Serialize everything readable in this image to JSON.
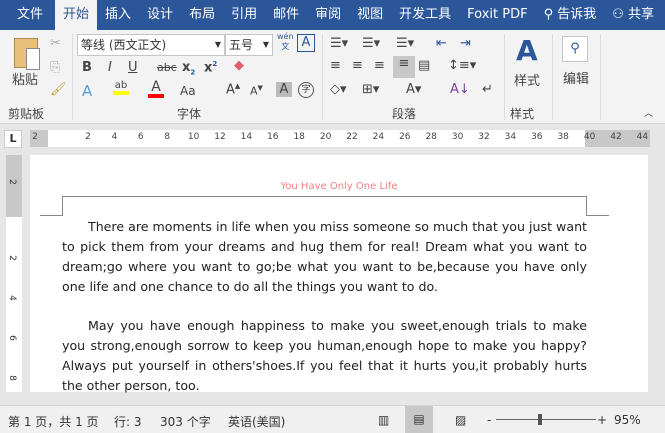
{
  "tabs": [
    "文件",
    "开始",
    "插入",
    "设计",
    "布局",
    "引用",
    "邮件",
    "审阅",
    "视图",
    "开发工具",
    "Foxit PDF"
  ],
  "active_tab": "开始",
  "tell_me": "告诉我",
  "share": "共享",
  "ribbon": {
    "paste": "粘贴",
    "font_name": "等线 (西文正文)",
    "font_size": "五号",
    "styles": "样式",
    "editing": "编辑",
    "groups": {
      "clipboard": "剪贴板",
      "font": "字体",
      "paragraph": "段落",
      "styles": "样式"
    },
    "bold": "B",
    "italic": "I",
    "underline": "U",
    "strike": "abc",
    "aa": "Aa",
    "pinyin_top": "wén",
    "pinyin_bottom": "文",
    "char_border": "A",
    "enclose": "字",
    "highlight_color": "#ffff00",
    "font_color": "#ff0000"
  },
  "ruler": {
    "h_ticks": [
      "2",
      "2",
      "4",
      "6",
      "8",
      "10",
      "12",
      "14",
      "16",
      "18",
      "20",
      "22",
      "24",
      "26",
      "28",
      "30",
      "32",
      "34",
      "36",
      "38",
      "40",
      "42",
      "44"
    ],
    "v_ticks": [
      "1",
      "2",
      "1",
      "2",
      "4",
      "6",
      "8"
    ],
    "tab_selector": "L"
  },
  "document": {
    "header": "You Have Only One Life",
    "paragraphs": [
      "There are moments in life when you miss someone so much that you just want to pick them from your dreams and hug them for real! Dream what you want to dream;go where you want to go;be what you want to be,because you have only one life and one chance to do all the things you want to do.",
      "May you have enough happiness to make you sweet,enough trials to make you strong,enough sorrow to keep you human,enough hope to make you happy? Always put yourself in others'shoes.If you feel that it hurts you,it probably hurts the other person, too."
    ]
  },
  "status": {
    "page": "第 1 页，共 1 页",
    "line": "行: 3",
    "words": "303 个字",
    "language": "英语(美国)",
    "zoom": "95%",
    "zoom_minus": "-",
    "zoom_plus": "+",
    "zoom_level_percent": 95
  }
}
